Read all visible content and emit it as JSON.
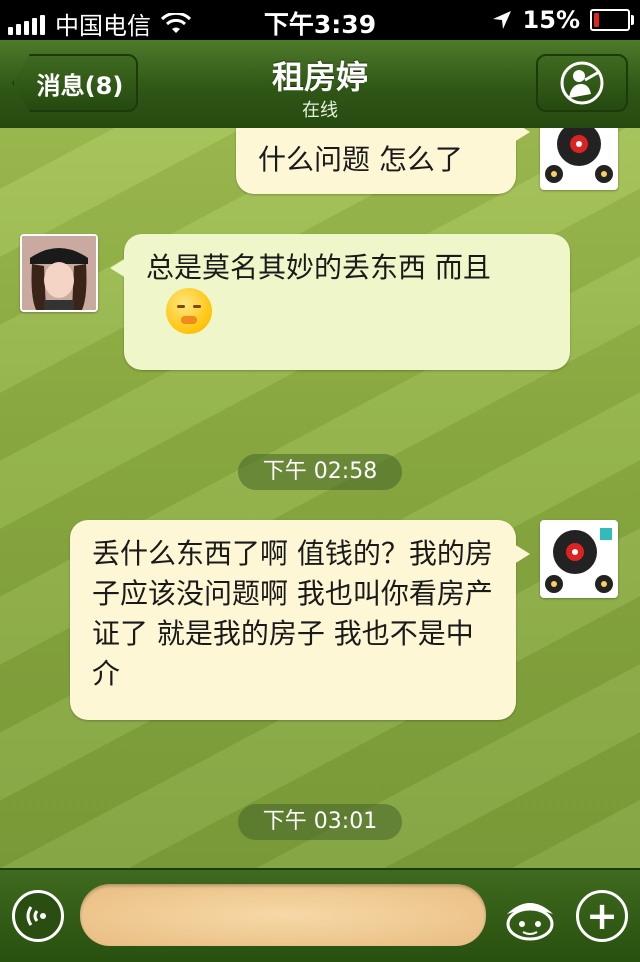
{
  "status_bar": {
    "carrier": "中国电信",
    "time": "下午3:39",
    "battery_percent": "15%",
    "battery_level": 0.15
  },
  "nav": {
    "back_label": "消息(8)",
    "title": "租房婷",
    "subtitle": "在线"
  },
  "messages": [
    {
      "side": "out",
      "text": "什么问题 怎么了"
    },
    {
      "side": "in",
      "text": "总是莫名其妙的丢东西  而且",
      "emoji": "hiding-face-emoji"
    },
    {
      "side": "out",
      "text": "丢什么东西了啊 值钱的？我的房子应该没问题啊 我也叫你看房产证了 就是我的房子 我也不是中介"
    }
  ],
  "timestamps": [
    "下午 02:58",
    "下午 03:01"
  ],
  "input": {
    "placeholder": ""
  },
  "colors": {
    "nav": "#2f5716",
    "chat_bg": "#8fb043",
    "bubble_out": "#fdf7d5",
    "bubble_in": "#eff6c9"
  }
}
